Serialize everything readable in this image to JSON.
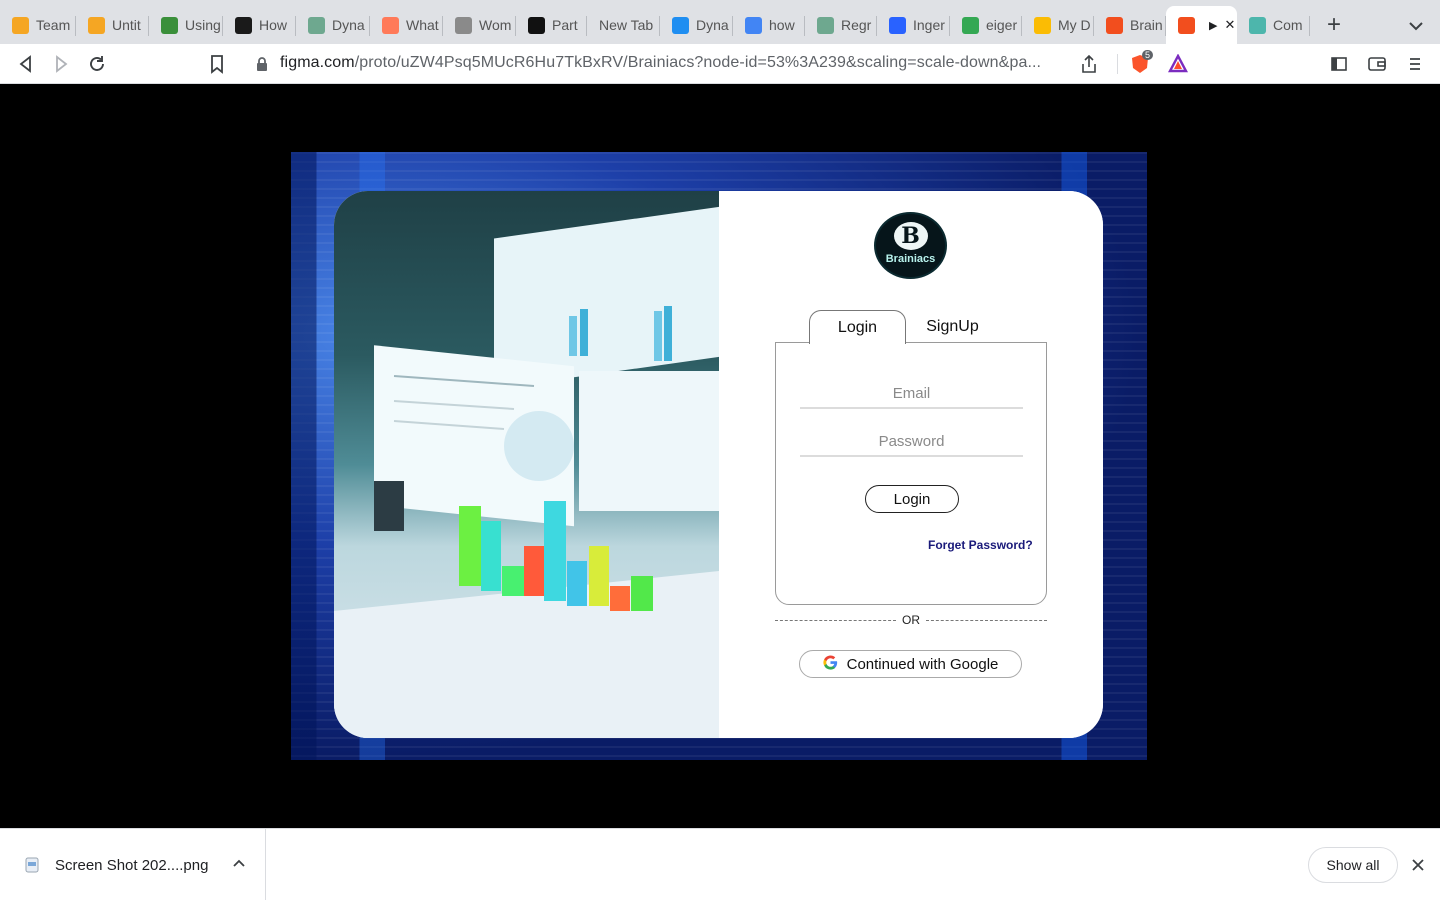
{
  "browser": {
    "tabs": [
      {
        "label": "Team",
        "icon": "infinity-icon",
        "color": "#f5a623"
      },
      {
        "label": "Untit",
        "icon": "infinity-icon",
        "color": "#f5a623"
      },
      {
        "label": "Using",
        "icon": "link-icon",
        "color": "#3a8f3a"
      },
      {
        "label": "How",
        "icon": "play-circle-icon",
        "color": "#1a1a1a"
      },
      {
        "label": "Dyna",
        "icon": "openai-icon",
        "color": "#6ea88f"
      },
      {
        "label": "What",
        "icon": "hubspot-icon",
        "color": "#ff7a59"
      },
      {
        "label": "Wom",
        "icon": "eyes-icon",
        "color": "#8a8a8a"
      },
      {
        "label": "Part",
        "icon": "analytics-icon",
        "color": "#111111"
      },
      {
        "label": "New Tab",
        "icon": "",
        "color": ""
      },
      {
        "label": "Dyna",
        "icon": "ai-icon",
        "color": "#1f8ef1"
      },
      {
        "label": "how",
        "icon": "google-icon",
        "color": "#4285f4"
      },
      {
        "label": "Regr",
        "icon": "openai-icon",
        "color": "#6ea88f"
      },
      {
        "label": "Inger",
        "icon": "doc-icon",
        "color": "#2962ff"
      },
      {
        "label": "eiger",
        "icon": "drive-icon",
        "color": "#34a853"
      },
      {
        "label": "My D",
        "icon": "drive-icon",
        "color": "#fbbc04"
      },
      {
        "label": "Brain",
        "icon": "figma-icon",
        "color": "#f24e1e"
      },
      {
        "label": "",
        "icon": "figma-icon",
        "color": "#f24e1e"
      },
      {
        "label": "Com",
        "icon": "leaf-icon",
        "color": "#4db6ac"
      }
    ],
    "new_tab_symbol": "+",
    "url_host": "figma.com",
    "url_path": "/proto/uZW4Psq5MUcR6Hu7TkBxRV/Brainiacs?node-id=53%3A239&scaling=scale-down&pa...",
    "shield_count": "5"
  },
  "app": {
    "logo_letter": "B",
    "logo_name": "Brainiacs",
    "tab_login": "Login",
    "tab_signup": "SignUp",
    "email_placeholder": "Email",
    "password_placeholder": "Password",
    "login_button": "Login",
    "forgot_password": "Forget Password?",
    "or_text": "OR",
    "google_button": "Continued with Google"
  },
  "downloads": {
    "file_name": "Screen Shot 202....png",
    "show_all": "Show all"
  }
}
